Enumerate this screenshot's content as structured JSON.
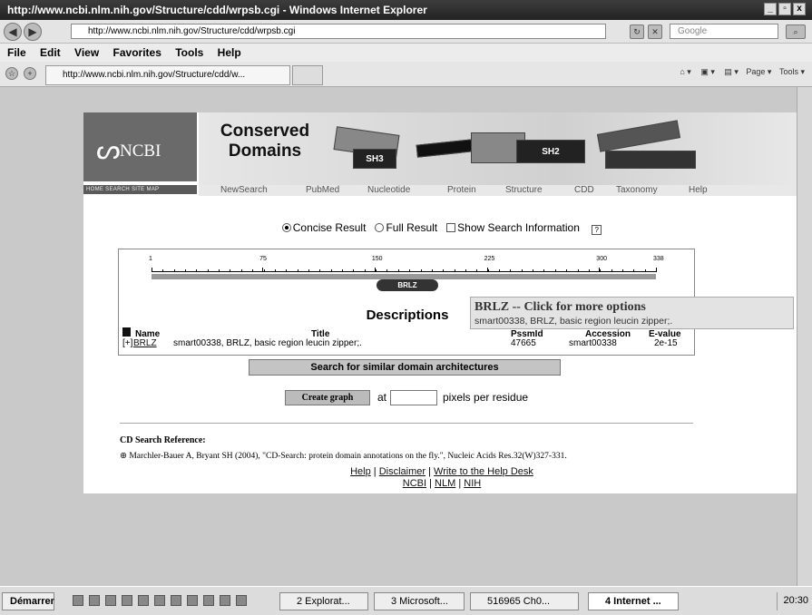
{
  "window": {
    "title": "http://www.ncbi.nlm.nih.gov/Structure/cdd/wrpsb.cgi - Windows Internet Explorer",
    "min": "_",
    "max": "▫",
    "close": "x"
  },
  "address_bar": {
    "url": "http://www.ncbi.nlm.nih.gov/Structure/cdd/wrpsb.cgi",
    "search_placeholder": "Google"
  },
  "menu": [
    "File",
    "Edit",
    "View",
    "Favorites",
    "Tools",
    "Help"
  ],
  "tab": {
    "label": "http://www.ncbi.nlm.nih.gov/Structure/cdd/w...",
    "page_label": "Page ▾",
    "tools_label": "Tools ▾"
  },
  "ncbi": {
    "logo": "NCBI",
    "mini_links": "HOME   SEARCH   SITE MAP",
    "banner_title_1": "Conserved",
    "banner_title_2": "Domains",
    "piece_sh3": "SH3",
    "piece_sh2": "SH2",
    "nav": [
      "NewSearch",
      "PubMed",
      "Nucleotide",
      "Protein",
      "Structure",
      "CDD",
      "Taxonomy",
      "Help"
    ]
  },
  "options": {
    "concise": "Concise Result",
    "full": "Full Result",
    "show_info": "Show Search Information",
    "help": "?"
  },
  "graphic": {
    "ticks": [
      "1",
      "75",
      "150",
      "225",
      "300",
      "338"
    ],
    "domain_label": "BRLZ",
    "descriptions_heading": "Descriptions"
  },
  "table": {
    "headers": {
      "name": "Name",
      "title": "Title",
      "pssmid": "PssmId",
      "accession": "Accession",
      "evalue": "E-value"
    },
    "rows": [
      {
        "expand": "[+]",
        "name": "BRLZ",
        "title": "smart00338, BRLZ, basic region leucin zipper;.",
        "pssmid": "47665",
        "accession": "smart00338",
        "evalue": "2e-15"
      }
    ]
  },
  "tooltip": {
    "title": "BRLZ -- Click for more options",
    "text": "smart00338, BRLZ, basic region leucin zipper;."
  },
  "arch_button": "Search for similar domain architectures",
  "graph": {
    "button": "Create graph",
    "at": "at",
    "input_value": "",
    "suffix": "pixels per residue"
  },
  "reference": {
    "heading": "CD Search Reference:",
    "citation": "Marchler-Bauer A, Bryant SH (2004), \"CD-Search: protein domain annotations on the fly.\", Nucleic Acids Res.32(W)327-331."
  },
  "footer": {
    "help": "Help",
    "disclaimer": "Disclaimer",
    "write": "Write to the Help Desk",
    "ncbi": "NCBI",
    "nlm": "NLM",
    "nih": "NIH",
    "sep": "|"
  },
  "taskbar": {
    "start": "Démarrer",
    "items": [
      "2 Explorat...",
      "3 Microsoft...",
      "516965 Ch0...",
      "4 Internet ..."
    ],
    "clock": "20:30"
  }
}
